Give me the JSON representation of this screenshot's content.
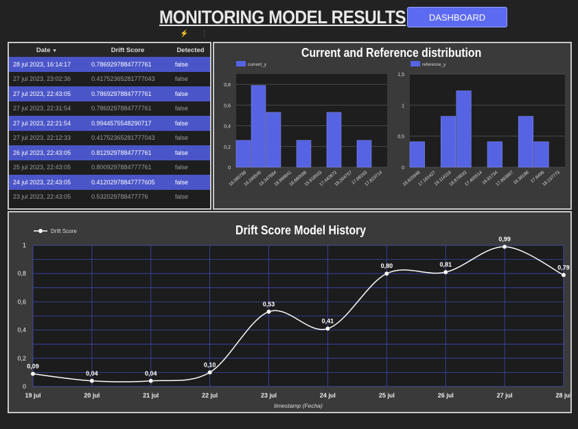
{
  "header": {
    "title": "MONITORING MODEL RESULTS",
    "dashboard_button": "DASHBOARD"
  },
  "icons": {
    "toolbar": [
      "lightning-icon",
      "more-vert-icon"
    ]
  },
  "table": {
    "columns": [
      "Date",
      "Drift Score",
      "Detected"
    ],
    "sort_indicator": "▼",
    "rows": [
      {
        "date": "28 jul 2023, 16:14:17",
        "score": "0.7869297884777761",
        "detected": "false",
        "highlight": true
      },
      {
        "date": "27 jul 2023, 23:02:36",
        "score": "0.41752365281777043",
        "detected": "false",
        "highlight": false
      },
      {
        "date": "27 jul 2023, 22:43:05",
        "score": "0.7869297884777761",
        "detected": "false",
        "highlight": true
      },
      {
        "date": "27 jul 2023, 22:31:54",
        "score": "0.7869297884777761",
        "detected": "false",
        "highlight": false
      },
      {
        "date": "27 jul 2023, 22:21:54",
        "score": "0.9944575548290717",
        "detected": "false",
        "highlight": true
      },
      {
        "date": "27 jul 2023, 22:12:33",
        "score": "0.41752365281777043",
        "detected": "false",
        "highlight": false
      },
      {
        "date": "26 jul 2023, 22:43:05",
        "score": "0.8129297884777761",
        "detected": "false",
        "highlight": true
      },
      {
        "date": "25 jul 2023, 22:43:05",
        "score": "0.8009297884777761",
        "detected": "false",
        "highlight": false
      },
      {
        "date": "24 jul 2023, 22:43:05",
        "score": "0.41202978847777605",
        "detected": "false",
        "highlight": true
      },
      {
        "date": "23 jul 2023, 22:43:05",
        "score": "0.532029788477776",
        "detected": "false",
        "highlight": false
      }
    ]
  },
  "colors": {
    "accent": "#5b6af0",
    "bar": "#5663e3",
    "line": "#ffffff"
  },
  "chart_data": [
    {
      "type": "bar",
      "title": "Current and Reference distribution",
      "legend": "current_y",
      "categories": [
        "18.585799",
        "16.299545",
        "19.347884",
        "18.966841",
        "16.680588",
        "15.918503",
        "17.442672",
        "18.204757",
        "17.06163",
        "17.823714"
      ],
      "values": [
        0.26,
        0.79,
        0.53,
        0,
        0.26,
        0,
        0.53,
        0,
        0.26,
        0
      ],
      "bars_layout": [
        0.26,
        0.79,
        0.53,
        0,
        0.26,
        0,
        0.53,
        0,
        0.26
      ],
      "ylim": [
        0,
        0.9
      ],
      "yticks": [
        "0",
        "0,2",
        "0,4",
        "0,6",
        "0,8"
      ]
    },
    {
      "type": "bar",
      "legend": "reference_y",
      "categories": [
        "18.625946",
        "17.161427",
        "19.114119",
        "18.870033",
        "17.405514",
        "16.91734",
        "17.893687",
        "18.38186",
        "17.6496",
        "18.137773"
      ],
      "values": [
        0.41,
        0,
        0.82,
        1.23,
        0,
        0.41,
        0,
        0.82,
        0.41,
        0
      ],
      "ylim": [
        0,
        1.5
      ],
      "yticks": [
        "0",
        "0,5",
        "1",
        "1,5"
      ]
    },
    {
      "type": "line",
      "title": "Drift Score Model History",
      "legend": "Drift Score",
      "xlabel": "timestamp (Fecha)",
      "x": [
        "19 jul",
        "20 jul",
        "21 jul",
        "22 jul",
        "23 jul",
        "24 jul",
        "25 jul",
        "26 jul",
        "27 jul",
        "28 jul"
      ],
      "values": [
        0.09,
        0.04,
        0.04,
        0.1,
        0.53,
        0.41,
        0.8,
        0.81,
        0.99,
        0.79
      ],
      "labels": [
        "0,09",
        "0,04",
        "0,04",
        "0,10",
        "0,53",
        "0,41",
        "0,80",
        "0,81",
        "0,99",
        "0,79"
      ],
      "ylim": [
        0,
        1
      ],
      "yticks": [
        "0",
        "0,2",
        "0,4",
        "0,6",
        "0,8",
        "1"
      ]
    }
  ]
}
